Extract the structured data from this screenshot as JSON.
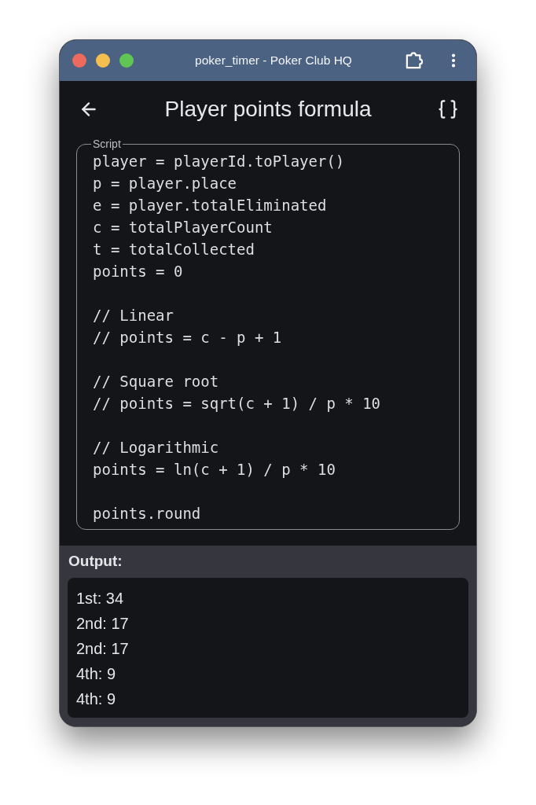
{
  "window": {
    "title": "poker_timer - Poker Club HQ"
  },
  "header": {
    "title": "Player points formula"
  },
  "script": {
    "label": "Script",
    "blocks": [
      [
        "player = playerId.toPlayer()",
        "p = player.place",
        "e = player.totalEliminated",
        "c = totalPlayerCount",
        "t = totalCollected",
        "points = 0"
      ],
      [
        "// Linear",
        "// points = c - p + 1"
      ],
      [
        "// Square root",
        "// points = sqrt(c + 1) / p * 10"
      ],
      [
        "// Logarithmic",
        "points = ln(c + 1) / p * 10"
      ],
      [
        "points.round"
      ]
    ]
  },
  "output": {
    "label": "Output:",
    "lines": [
      "1st: 34",
      "2nd: 17",
      "2nd: 17",
      "4th: 9",
      "4th: 9"
    ]
  }
}
